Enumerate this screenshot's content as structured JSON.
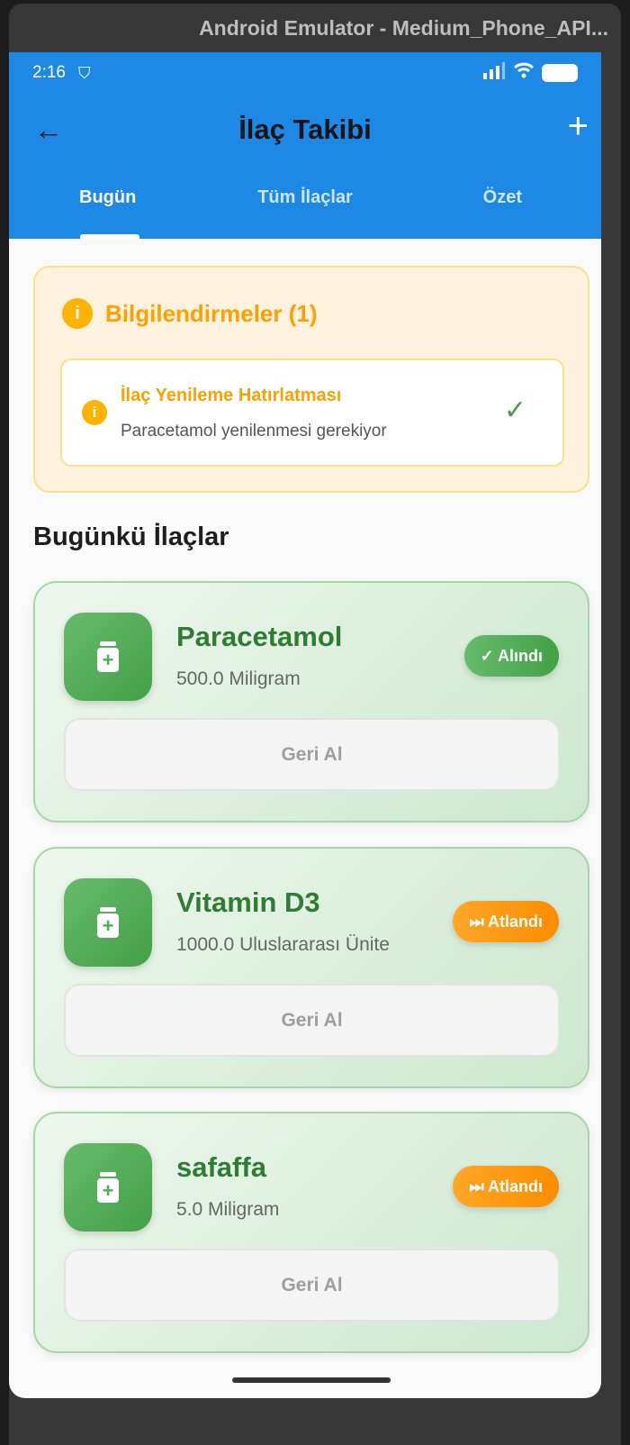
{
  "window": {
    "title": "Android Emulator - Medium_Phone_API..."
  },
  "status_bar": {
    "time": "2:16"
  },
  "app_bar": {
    "title": "İlaç Takibi"
  },
  "tabs": [
    {
      "label": "Bugün",
      "active": true
    },
    {
      "label": "Tüm İlaçlar",
      "active": false
    },
    {
      "label": "Özet",
      "active": false
    }
  ],
  "notifications": {
    "heading": "Bilgilendirmeler (1)",
    "items": [
      {
        "title": "İlaç Yenileme Hatırlatması",
        "message": "Paracetamol yenilenmesi gerekiyor"
      }
    ]
  },
  "section_title": "Bugünkü İlaçlar",
  "medications": [
    {
      "name": "Paracetamol",
      "dose": "500.0 Miligram",
      "status": "✓ Alındı",
      "undo": "Geri Al"
    },
    {
      "name": "Vitamin D3",
      "dose": "1000.0 Uluslararası Ünite",
      "status": "⏭ Atlandı",
      "undo": "Geri Al"
    },
    {
      "name": "safaffa",
      "dose": "5.0 Miligram",
      "status": "⏭ Atlandı",
      "undo": "Geri Al"
    }
  ],
  "colors": {
    "primary": "#1e88e5",
    "success": "#43a047",
    "warning": "#fb8c00",
    "info": "#ffa000"
  }
}
